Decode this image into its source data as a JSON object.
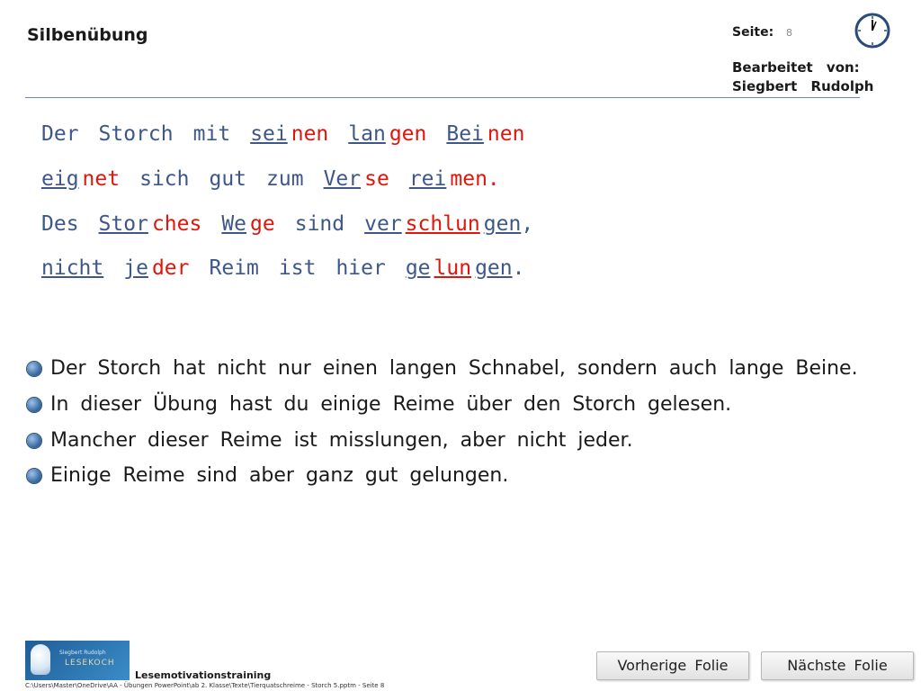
{
  "header": {
    "title": "Silbenübung",
    "page_label": "Seite:",
    "page_number": "8",
    "edited_line1": "Bearbeitet von:",
    "edited_line2": "Siegbert Rudolph"
  },
  "poem": {
    "line1": [
      [
        [
          "p",
          "Der"
        ]
      ],
      [
        [
          "p",
          "Storch"
        ]
      ],
      [
        [
          "p",
          "mit"
        ]
      ],
      [
        [
          "b",
          "sei"
        ],
        [
          "r",
          "nen"
        ]
      ],
      [
        [
          "b",
          "lan"
        ],
        [
          "r",
          "gen"
        ]
      ],
      [
        [
          "b",
          "Bei"
        ],
        [
          "r",
          "nen"
        ]
      ]
    ],
    "line2": [
      [
        [
          "b",
          "eig"
        ],
        [
          "r",
          "net"
        ]
      ],
      [
        [
          "p",
          "sich"
        ]
      ],
      [
        [
          "p",
          "gut"
        ]
      ],
      [
        [
          "p",
          "zum"
        ]
      ],
      [
        [
          "b",
          "Ver"
        ],
        [
          "r",
          "se"
        ]
      ],
      [
        [
          "b",
          "rei"
        ],
        [
          "r",
          "men."
        ]
      ]
    ],
    "line3": [
      [
        [
          "p",
          "Des"
        ]
      ],
      [
        [
          "b",
          "Stor"
        ],
        [
          "r",
          "ches"
        ]
      ],
      [
        [
          "b",
          "We"
        ],
        [
          "r",
          "ge"
        ]
      ],
      [
        [
          "p",
          "sind"
        ]
      ],
      [
        [
          "b",
          "ver"
        ],
        [
          "ru",
          "schlun"
        ],
        [
          "b",
          "gen"
        ],
        [
          "p",
          ","
        ]
      ]
    ],
    "line4": [
      [
        [
          "b",
          "nicht"
        ]
      ],
      [
        [
          "b",
          "je"
        ],
        [
          "r",
          "der"
        ]
      ],
      [
        [
          "p",
          "Reim"
        ]
      ],
      [
        [
          "p",
          "ist"
        ]
      ],
      [
        [
          "p",
          "hier"
        ]
      ],
      [
        [
          "b",
          "ge"
        ],
        [
          "ru",
          "lun"
        ],
        [
          "b",
          "gen"
        ],
        [
          "p",
          "."
        ]
      ]
    ]
  },
  "bullets": [
    "Der Storch hat nicht nur einen langen Schnabel, sondern auch lange Beine.",
    "In dieser Übung hast du einige Reime über den Storch gelesen.",
    "Mancher dieser Reime ist misslungen, aber nicht jeder.",
    "Einige Reime sind aber ganz gut gelungen."
  ],
  "footer": {
    "logo_line1": "Siegbert Rudolph",
    "logo_line2": "LESEKOCH",
    "label": "Lesemotivationstraining",
    "path": "C:\\Users\\Master\\OneDrive\\AA - Übungen PowerPoint\\ab 2. Klasse\\Texte\\Tierquatschreime - Storch 5.pptm - Seite 8"
  },
  "nav": {
    "prev_label": "Vorherige Folie",
    "next_label": "Nächste Folie"
  },
  "icons": {
    "clock": "clock-icon",
    "bullet": "bullet-dot-icon",
    "logo": "lesekoch-logo"
  },
  "colors": {
    "blue_syllable": "#3d5888",
    "red_syllable": "#e0160c",
    "rule": "#6d8bb0",
    "bullet": "#3e6fa6"
  }
}
